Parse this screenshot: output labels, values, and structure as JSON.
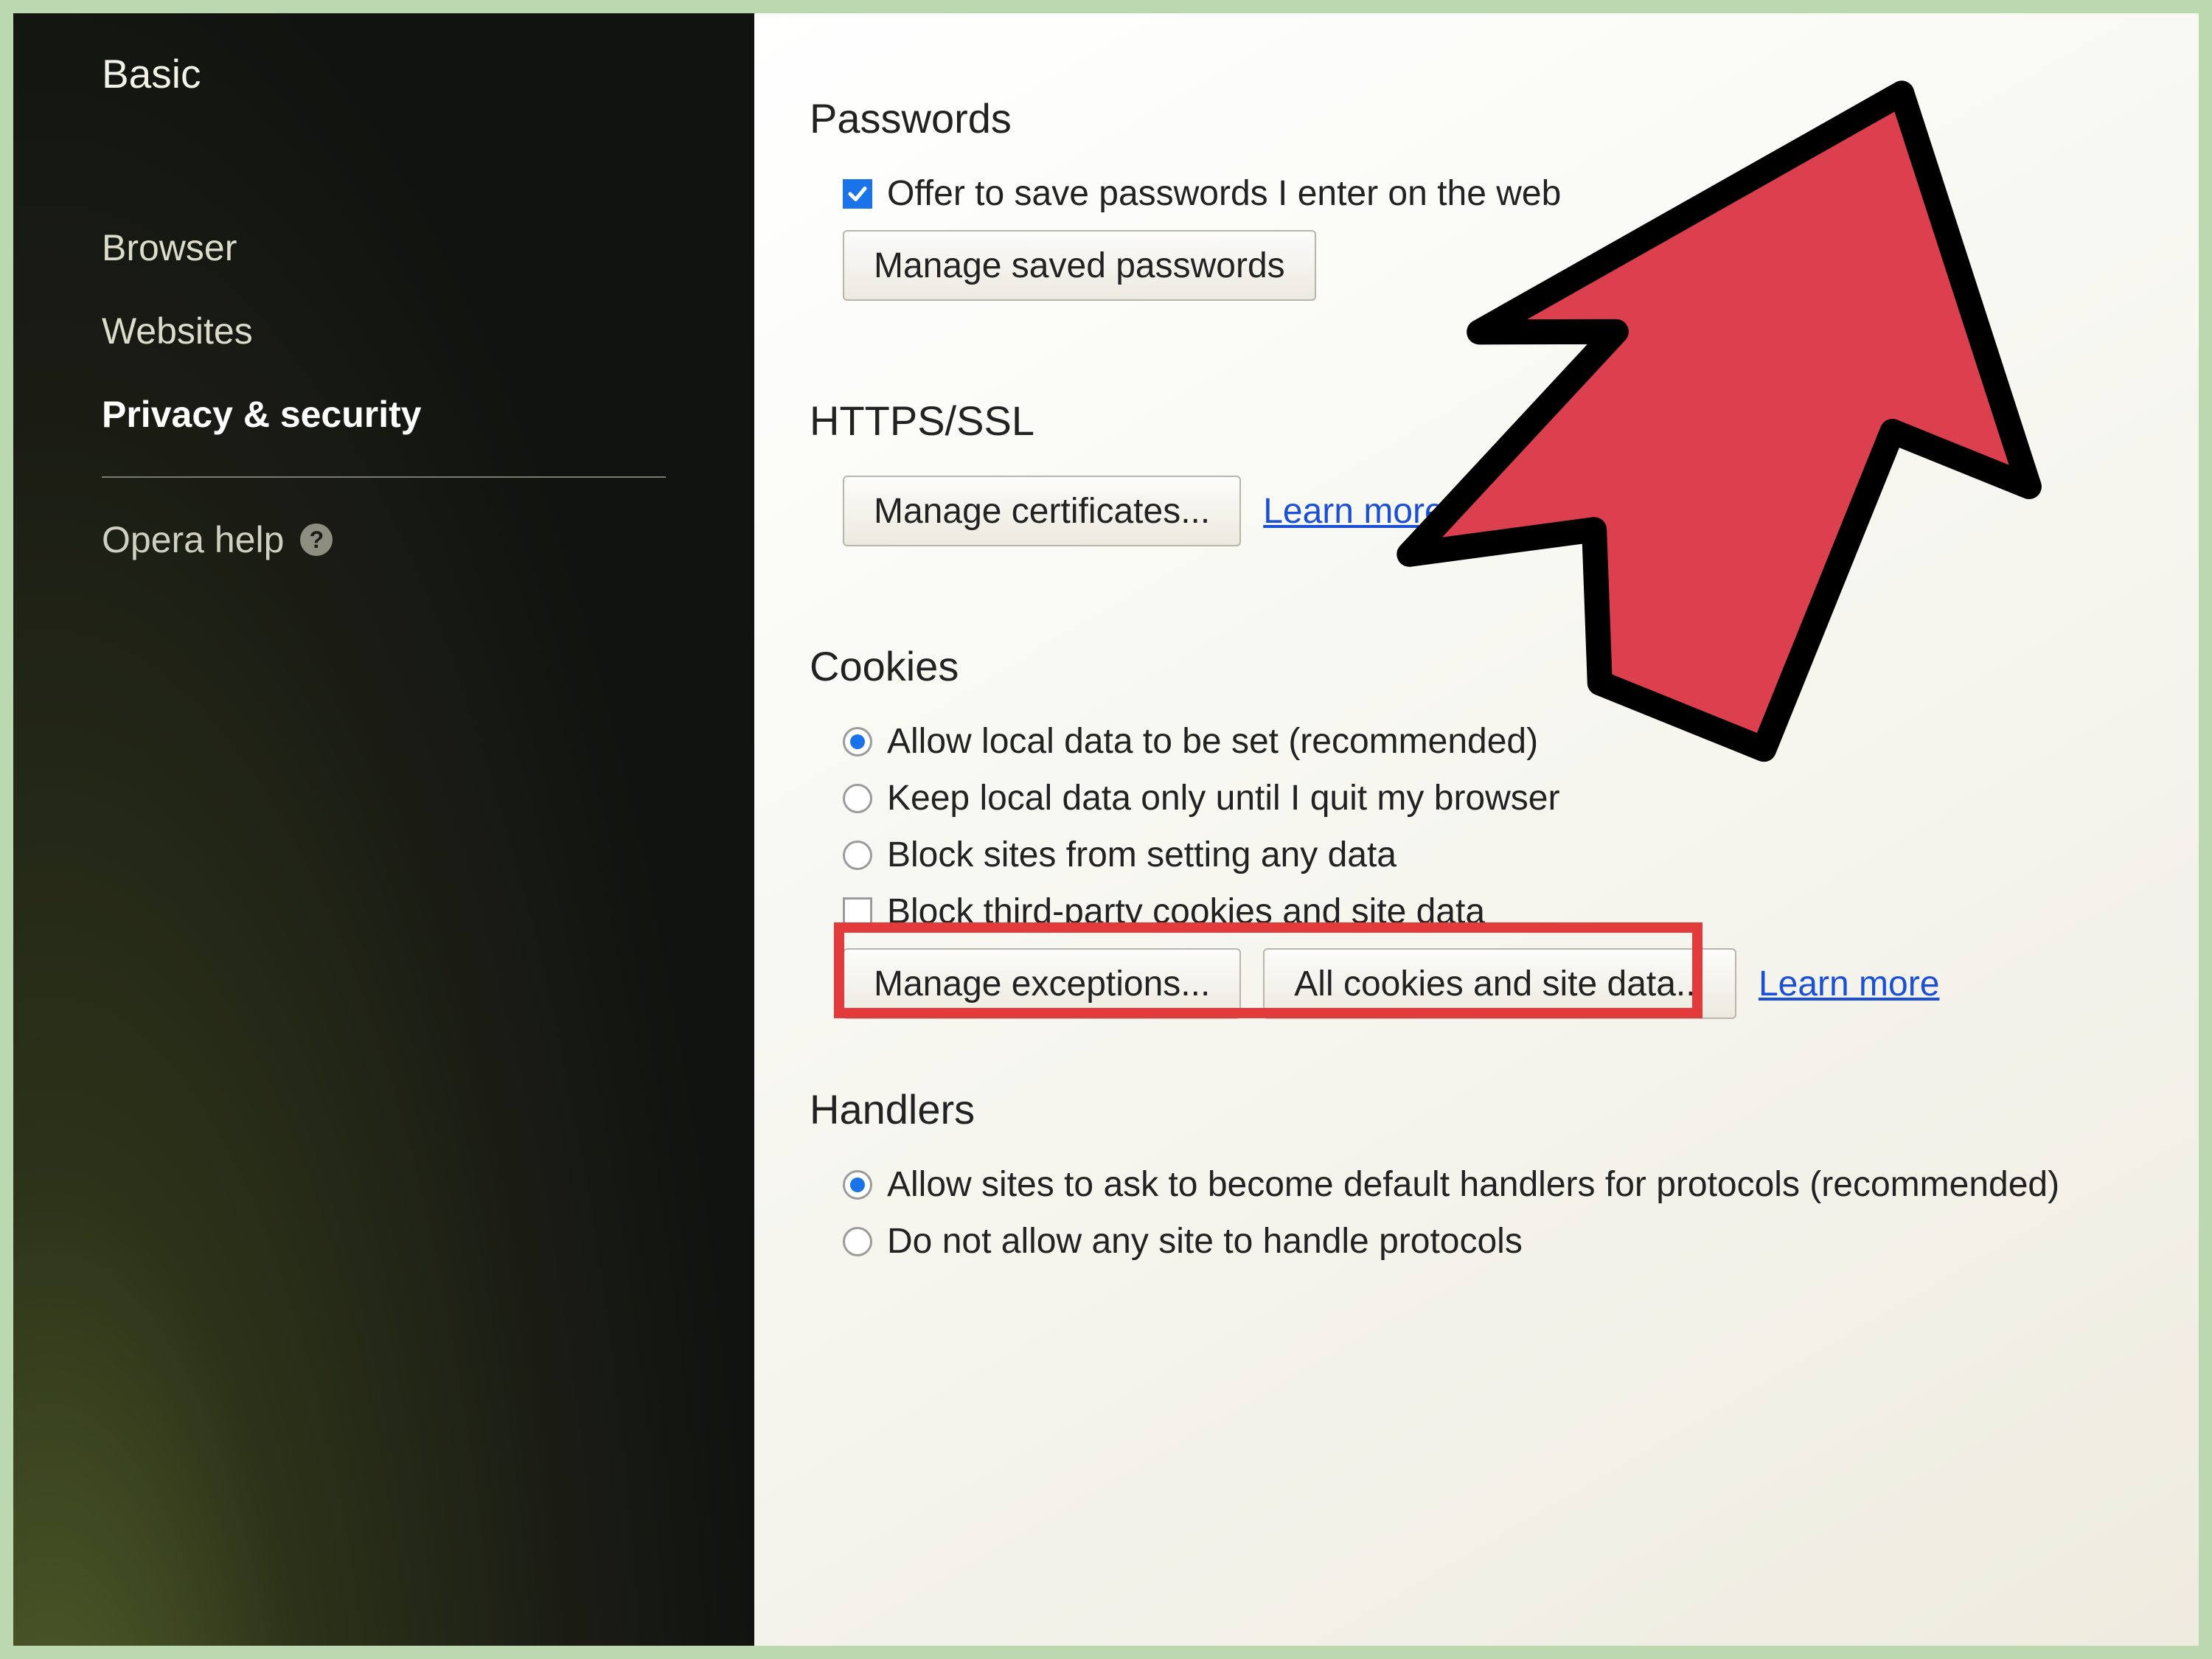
{
  "sidebar": {
    "title": "Basic",
    "items": [
      {
        "label": "Browser",
        "active": false
      },
      {
        "label": "Websites",
        "active": false
      },
      {
        "label": "Privacy & security",
        "active": true
      }
    ],
    "help_label": "Opera help"
  },
  "sections": {
    "passwords": {
      "heading": "Passwords",
      "offer_save_label": "Offer to save passwords I enter on the web",
      "offer_save_checked": true,
      "manage_button": "Manage saved passwords"
    },
    "https": {
      "heading": "HTTPS/SSL",
      "manage_certs_button": "Manage certificates...",
      "learn_more": "Learn more"
    },
    "cookies": {
      "heading": "Cookies",
      "radios": [
        {
          "label": "Allow local data to be set (recommended)",
          "selected": true
        },
        {
          "label": "Keep local data only until I quit my browser",
          "selected": false
        },
        {
          "label": "Block sites from setting any data",
          "selected": false
        }
      ],
      "block_third_party_label": "Block third-party cookies and site data",
      "block_third_party_checked": false,
      "manage_exceptions_button": "Manage exceptions...",
      "all_cookies_button": "All cookies and site data...",
      "learn_more": "Learn more"
    },
    "handlers": {
      "heading": "Handlers",
      "radios": [
        {
          "label": "Allow sites to ask to become default handlers for protocols (recommended)",
          "selected": true
        },
        {
          "label": "Do not allow any site to handle protocols",
          "selected": false
        }
      ]
    }
  }
}
